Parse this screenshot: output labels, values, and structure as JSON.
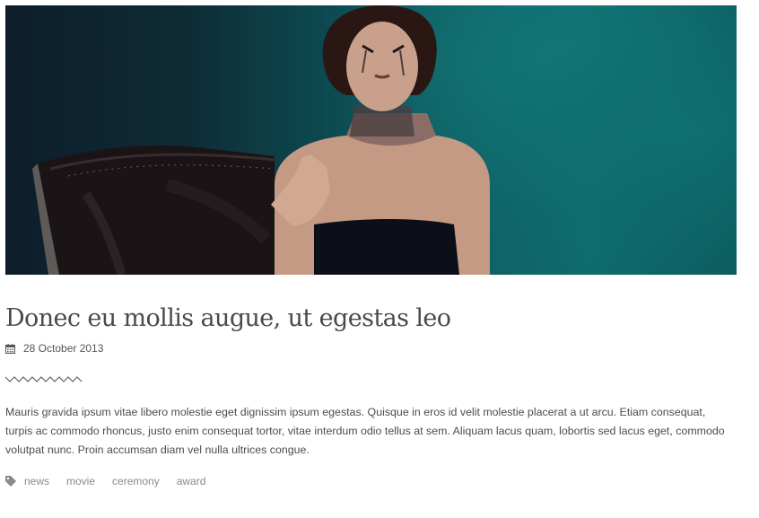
{
  "post": {
    "image": {
      "description_icon": "photo-image"
    },
    "title": "Donec eu mollis augue, ut egestas leo",
    "date": "28 October 2013",
    "date_icon": "calendar-icon",
    "excerpt": "Mauris gravida ipsum vitae libero molestie eget dignissim ipsum egestas. Quisque in eros id velit molestie placerat a ut arcu. Etiam consequat, turpis ac commodo rhoncus, justo enim consequat tortor, vitae interdum odio tellus at sem. Aliquam lacus quam, lobortis sed lacus eget, commodo volutpat nunc. Proin accumsan diam vel nulla ultrices congue.",
    "tag_icon": "tag-icon",
    "tags": [
      "news",
      "movie",
      "ceremony",
      "award"
    ]
  },
  "colors": {
    "title": "#4a4a4a",
    "text": "#4d4d4d",
    "muted": "#8a8a8a",
    "hero_teal": "#0f6b6d"
  }
}
